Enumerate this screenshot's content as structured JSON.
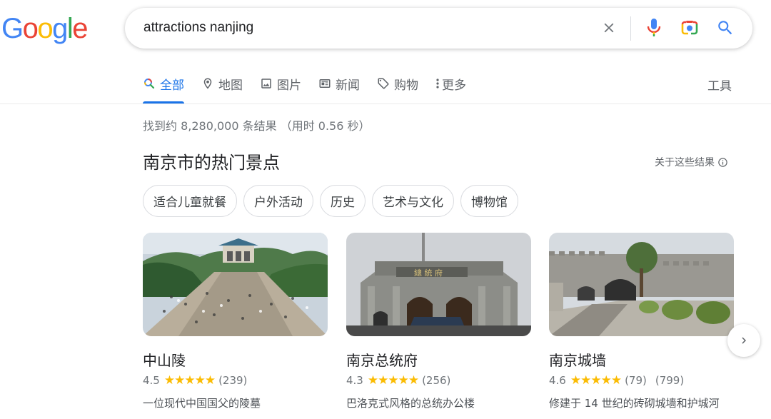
{
  "logo": {
    "letters": [
      "G",
      "o",
      "o",
      "g",
      "l",
      "e"
    ],
    "colors": [
      "#4285f4",
      "#ea4335",
      "#fbbc05",
      "#4285f4",
      "#34a853",
      "#ea4335"
    ]
  },
  "search": {
    "query": "attractions nanjing"
  },
  "tabs": [
    {
      "label": "全部",
      "icon": "search-icon",
      "active": true
    },
    {
      "label": "地图",
      "icon": "map-pin-icon",
      "active": false
    },
    {
      "label": "图片",
      "icon": "image-icon",
      "active": false
    },
    {
      "label": "新闻",
      "icon": "news-icon",
      "active": false
    },
    {
      "label": "购物",
      "icon": "tag-icon",
      "active": false
    },
    {
      "label": "更多",
      "icon": "more-vert-icon",
      "active": false
    }
  ],
  "tools_label": "工具",
  "stats": "找到约 8,280,000 条结果 （用时 0.56 秒）",
  "section": {
    "title": "南京市的热门景点",
    "about": "关于这些结果"
  },
  "chips": [
    "适合儿童就餐",
    "户外活动",
    "历史",
    "艺术与文化",
    "博物馆"
  ],
  "cards": [
    {
      "name": "中山陵",
      "rating": "4.5",
      "stars": "★★★★★",
      "reviews": "(239)",
      "extra": "",
      "description": "一位现代中国国父的陵墓"
    },
    {
      "name": "南京总统府",
      "rating": "4.3",
      "stars": "★★★★★",
      "reviews": "(256)",
      "extra": "",
      "description": "巴洛克式风格的总统办公楼"
    },
    {
      "name": "南京城墙",
      "rating": "4.6",
      "stars": "★★★★★",
      "reviews": "(79)",
      "extra": "(799)",
      "description": "修建于 14 世纪的砖砌城墙和护城河"
    }
  ],
  "colors": {
    "accent": "#1a73e8",
    "star": "#fbbc04",
    "muted": "#70757a"
  }
}
